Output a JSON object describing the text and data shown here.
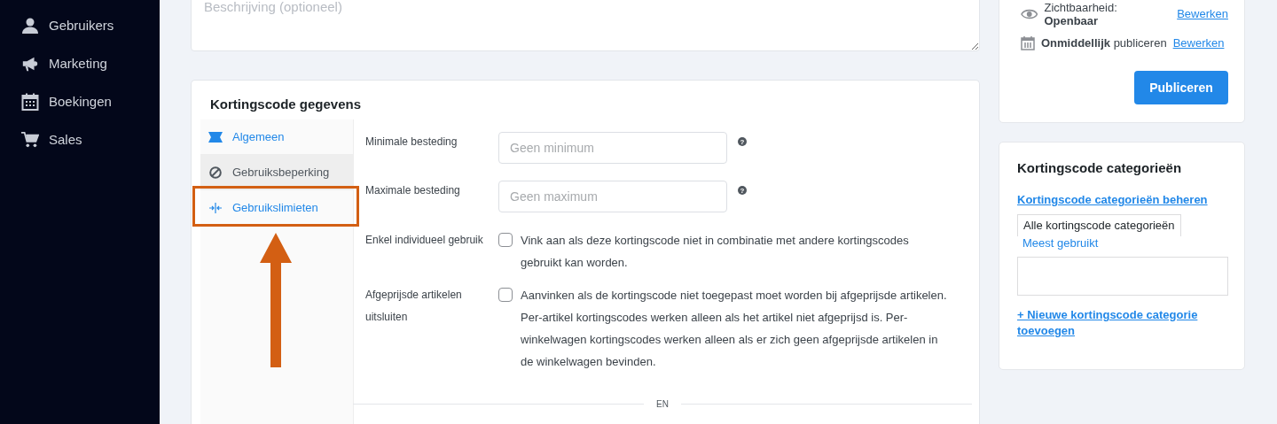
{
  "sidebar": {
    "items": [
      {
        "label": "Gebruikers"
      },
      {
        "label": "Marketing"
      },
      {
        "label": "Boekingen"
      },
      {
        "label": "Sales"
      }
    ]
  },
  "description_field": {
    "placeholder": "Beschrijving (optioneel)"
  },
  "discount_data": {
    "title": "Kortingscode gegevens",
    "tabs": [
      {
        "label": "Algemeen",
        "selected": false,
        "highlighted": false
      },
      {
        "label": "Gebruiksbeperking",
        "selected": true,
        "highlighted": false
      },
      {
        "label": "Gebruikslimieten",
        "selected": false,
        "highlighted": true
      }
    ],
    "fields": [
      {
        "kind": "input",
        "label": "Minimale besteding",
        "placeholder": "Geen minimum",
        "help": "?"
      },
      {
        "kind": "input",
        "label": "Maximale besteding",
        "placeholder": "Geen maximum",
        "help": "?"
      },
      {
        "kind": "checkbox",
        "label": "Enkel individueel gebruik",
        "checked": false,
        "description": "Vink aan als deze kortingscode niet in combinatie met andere kortingscodes gebruikt kan worden."
      },
      {
        "kind": "checkbox",
        "label": "Afgeprijsde artikelen uitsluiten",
        "checked": false,
        "description": "Aanvinken als de kortingscode niet toegepast moet worden bij afgeprijsde artikelen. Per-artikel kortingscodes werken alleen als het artikel niet afgeprijsd is. Per-winkelwagen kortingscodes werken alleen als er zich geen afgeprijsde artikelen in de winkelwagen bevinden."
      }
    ],
    "separator": "EN"
  },
  "publish": {
    "visibility": "Zichtbaarheid: **Openbaar**",
    "visibility_edit": "Bewerken",
    "schedule": "**Onmiddellijk** publiceren",
    "schedule_edit": "Bewerken",
    "button": "Publiceren"
  },
  "categories": {
    "title": "Kortingscode categorieën",
    "manage_link": "Kortingscode categorieën beheren",
    "tabs": [
      {
        "label": "Alle kortingscode categorieën",
        "selected": true
      },
      {
        "label": "Meest gebruikt",
        "selected": false
      }
    ],
    "add_link": "+ Nieuwe kortingscode categorie toevoegen"
  }
}
